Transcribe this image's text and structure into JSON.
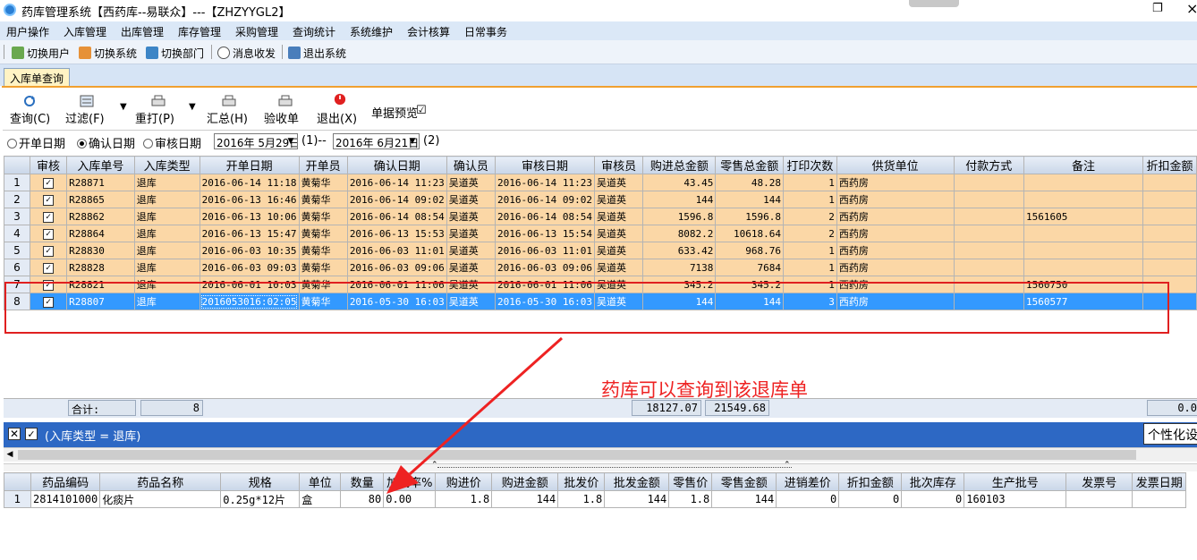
{
  "window": {
    "title": "药库管理系统【西药库--易联众】---【ZHZYYGL2】",
    "max_glyph": "❐",
    "close_glyph": "×"
  },
  "menubar": [
    "用户操作",
    "入库管理",
    "出库管理",
    "库存管理",
    "采购管理",
    "查询统计",
    "系统维护",
    "会计核算",
    "日常事务"
  ],
  "toolbar": {
    "switch_user": "切换用户",
    "switch_system": "切换系统",
    "switch_dept": "切换部门",
    "messages": "消息收发",
    "exit_system": "退出系统"
  },
  "tab": {
    "label": "入库单查询"
  },
  "query_toolbar": {
    "query": "查询(C)",
    "filter": "过滤(F)",
    "reprint": "重打(P)",
    "summary": "汇总(H)",
    "receipt": "验收单",
    "exit": "退出(X)",
    "preview": "单据预览"
  },
  "filter": {
    "options": [
      "开单日期",
      "确认日期",
      "审核日期"
    ],
    "selected": "确认日期",
    "date_from": "2016年 5月29日",
    "label_from": "(1)--",
    "date_to": "2016年 6月21日",
    "label_to": "(2)"
  },
  "grid1": {
    "headers": [
      "审核",
      "入库单号",
      "入库类型",
      "开单日期",
      "开单员",
      "确认日期",
      "确认员",
      "审核日期",
      "审核员",
      "购进总金额",
      "零售总金额",
      "打印次数",
      "供货单位",
      "付款方式",
      "备注",
      "折扣金额"
    ],
    "rows": [
      {
        "n": "1",
        "id": "R28871",
        "type": "退库",
        "open": "2016-06-14 11:18",
        "opener": "黄菊华",
        "confirm": "2016-06-14 11:23",
        "confirmer": "吴道英",
        "audit": "2016-06-14 11:23",
        "auditor": "吴道英",
        "purchase": "43.45",
        "retail": "48.28",
        "prints": "1",
        "supplier": "西药房",
        "pay": "",
        "note": ""
      },
      {
        "n": "2",
        "id": "R28865",
        "type": "退库",
        "open": "2016-06-13 16:46",
        "opener": "黄菊华",
        "confirm": "2016-06-14 09:02",
        "confirmer": "吴道英",
        "audit": "2016-06-14 09:02",
        "auditor": "吴道英",
        "purchase": "144",
        "retail": "144",
        "prints": "1",
        "supplier": "西药房",
        "pay": "",
        "note": ""
      },
      {
        "n": "3",
        "id": "R28862",
        "type": "退库",
        "open": "2016-06-13 10:06",
        "opener": "黄菊华",
        "confirm": "2016-06-14 08:54",
        "confirmer": "吴道英",
        "audit": "2016-06-14 08:54",
        "auditor": "吴道英",
        "purchase": "1596.8",
        "retail": "1596.8",
        "prints": "2",
        "supplier": "西药房",
        "pay": "",
        "note": "1561605"
      },
      {
        "n": "4",
        "id": "R28864",
        "type": "退库",
        "open": "2016-06-13 15:47",
        "opener": "黄菊华",
        "confirm": "2016-06-13 15:53",
        "confirmer": "吴道英",
        "audit": "2016-06-13 15:54",
        "auditor": "吴道英",
        "purchase": "8082.2",
        "retail": "10618.64",
        "prints": "2",
        "supplier": "西药房",
        "pay": "",
        "note": ""
      },
      {
        "n": "5",
        "id": "R28830",
        "type": "退库",
        "open": "2016-06-03 10:35",
        "opener": "黄菊华",
        "confirm": "2016-06-03 11:01",
        "confirmer": "吴道英",
        "audit": "2016-06-03 11:01",
        "auditor": "吴道英",
        "purchase": "633.42",
        "retail": "968.76",
        "prints": "1",
        "supplier": "西药房",
        "pay": "",
        "note": ""
      },
      {
        "n": "6",
        "id": "R28828",
        "type": "退库",
        "open": "2016-06-03 09:03",
        "opener": "黄菊华",
        "confirm": "2016-06-03 09:06",
        "confirmer": "吴道英",
        "audit": "2016-06-03 09:06",
        "auditor": "吴道英",
        "purchase": "7138",
        "retail": "7684",
        "prints": "1",
        "supplier": "西药房",
        "pay": "",
        "note": ""
      },
      {
        "n": "7",
        "id": "R28821",
        "type": "退库",
        "open": "2016-06-01 10:03",
        "opener": "黄菊华",
        "confirm": "2016-06-01 11:06",
        "confirmer": "吴道英",
        "audit": "2016-06-01 11:06",
        "auditor": "吴道英",
        "purchase": "345.2",
        "retail": "345.2",
        "prints": "1",
        "supplier": "西药房",
        "pay": "",
        "note": "1560750"
      },
      {
        "n": "8",
        "id": "R28807",
        "type": "退库",
        "open": "2016053016:02:05",
        "opener": "黄菊华",
        "confirm": "2016-05-30 16:03",
        "confirmer": "吴道英",
        "audit": "2016-05-30 16:03",
        "auditor": "吴道英",
        "purchase": "144",
        "retail": "144",
        "prints": "3",
        "supplier": "西药房",
        "pay": "",
        "note": "1560577"
      }
    ]
  },
  "summary": {
    "label": "合计:",
    "count": "8",
    "purchase_total": "18127.07",
    "retail_total": "21549.68",
    "discount_total": "0.0"
  },
  "filter_status": {
    "text": "(入库类型 = 退库)",
    "personal_button": "个性化设"
  },
  "grid2": {
    "headers": [
      "药品编码",
      "药品名称",
      "规格",
      "单位",
      "数量",
      "加成率%",
      "购进价",
      "购进金额",
      "批发价",
      "批发金额",
      "零售价",
      "零售金额",
      "进销差价",
      "折扣金额",
      "批次库存",
      "生产批号",
      "发票号",
      "发票日期"
    ],
    "rows": [
      {
        "n": "1",
        "cells": [
          "2814101000",
          "化痰片",
          "0.25g*12片",
          "盒",
          "80",
          "0.00",
          "1.8",
          "144",
          "1.8",
          "144",
          "1.8",
          "144",
          "0",
          "0",
          "0",
          "160103",
          "",
          ""
        ]
      }
    ]
  },
  "annotation": {
    "text": "药库可以查询到该退库单",
    "color": "#ee2222"
  },
  "colors": {
    "row_bg": "#fbd7a6",
    "selected_bg": "#3399ff",
    "filter_bar": "#2d68c4",
    "tab_bg": "#fff3c4"
  }
}
